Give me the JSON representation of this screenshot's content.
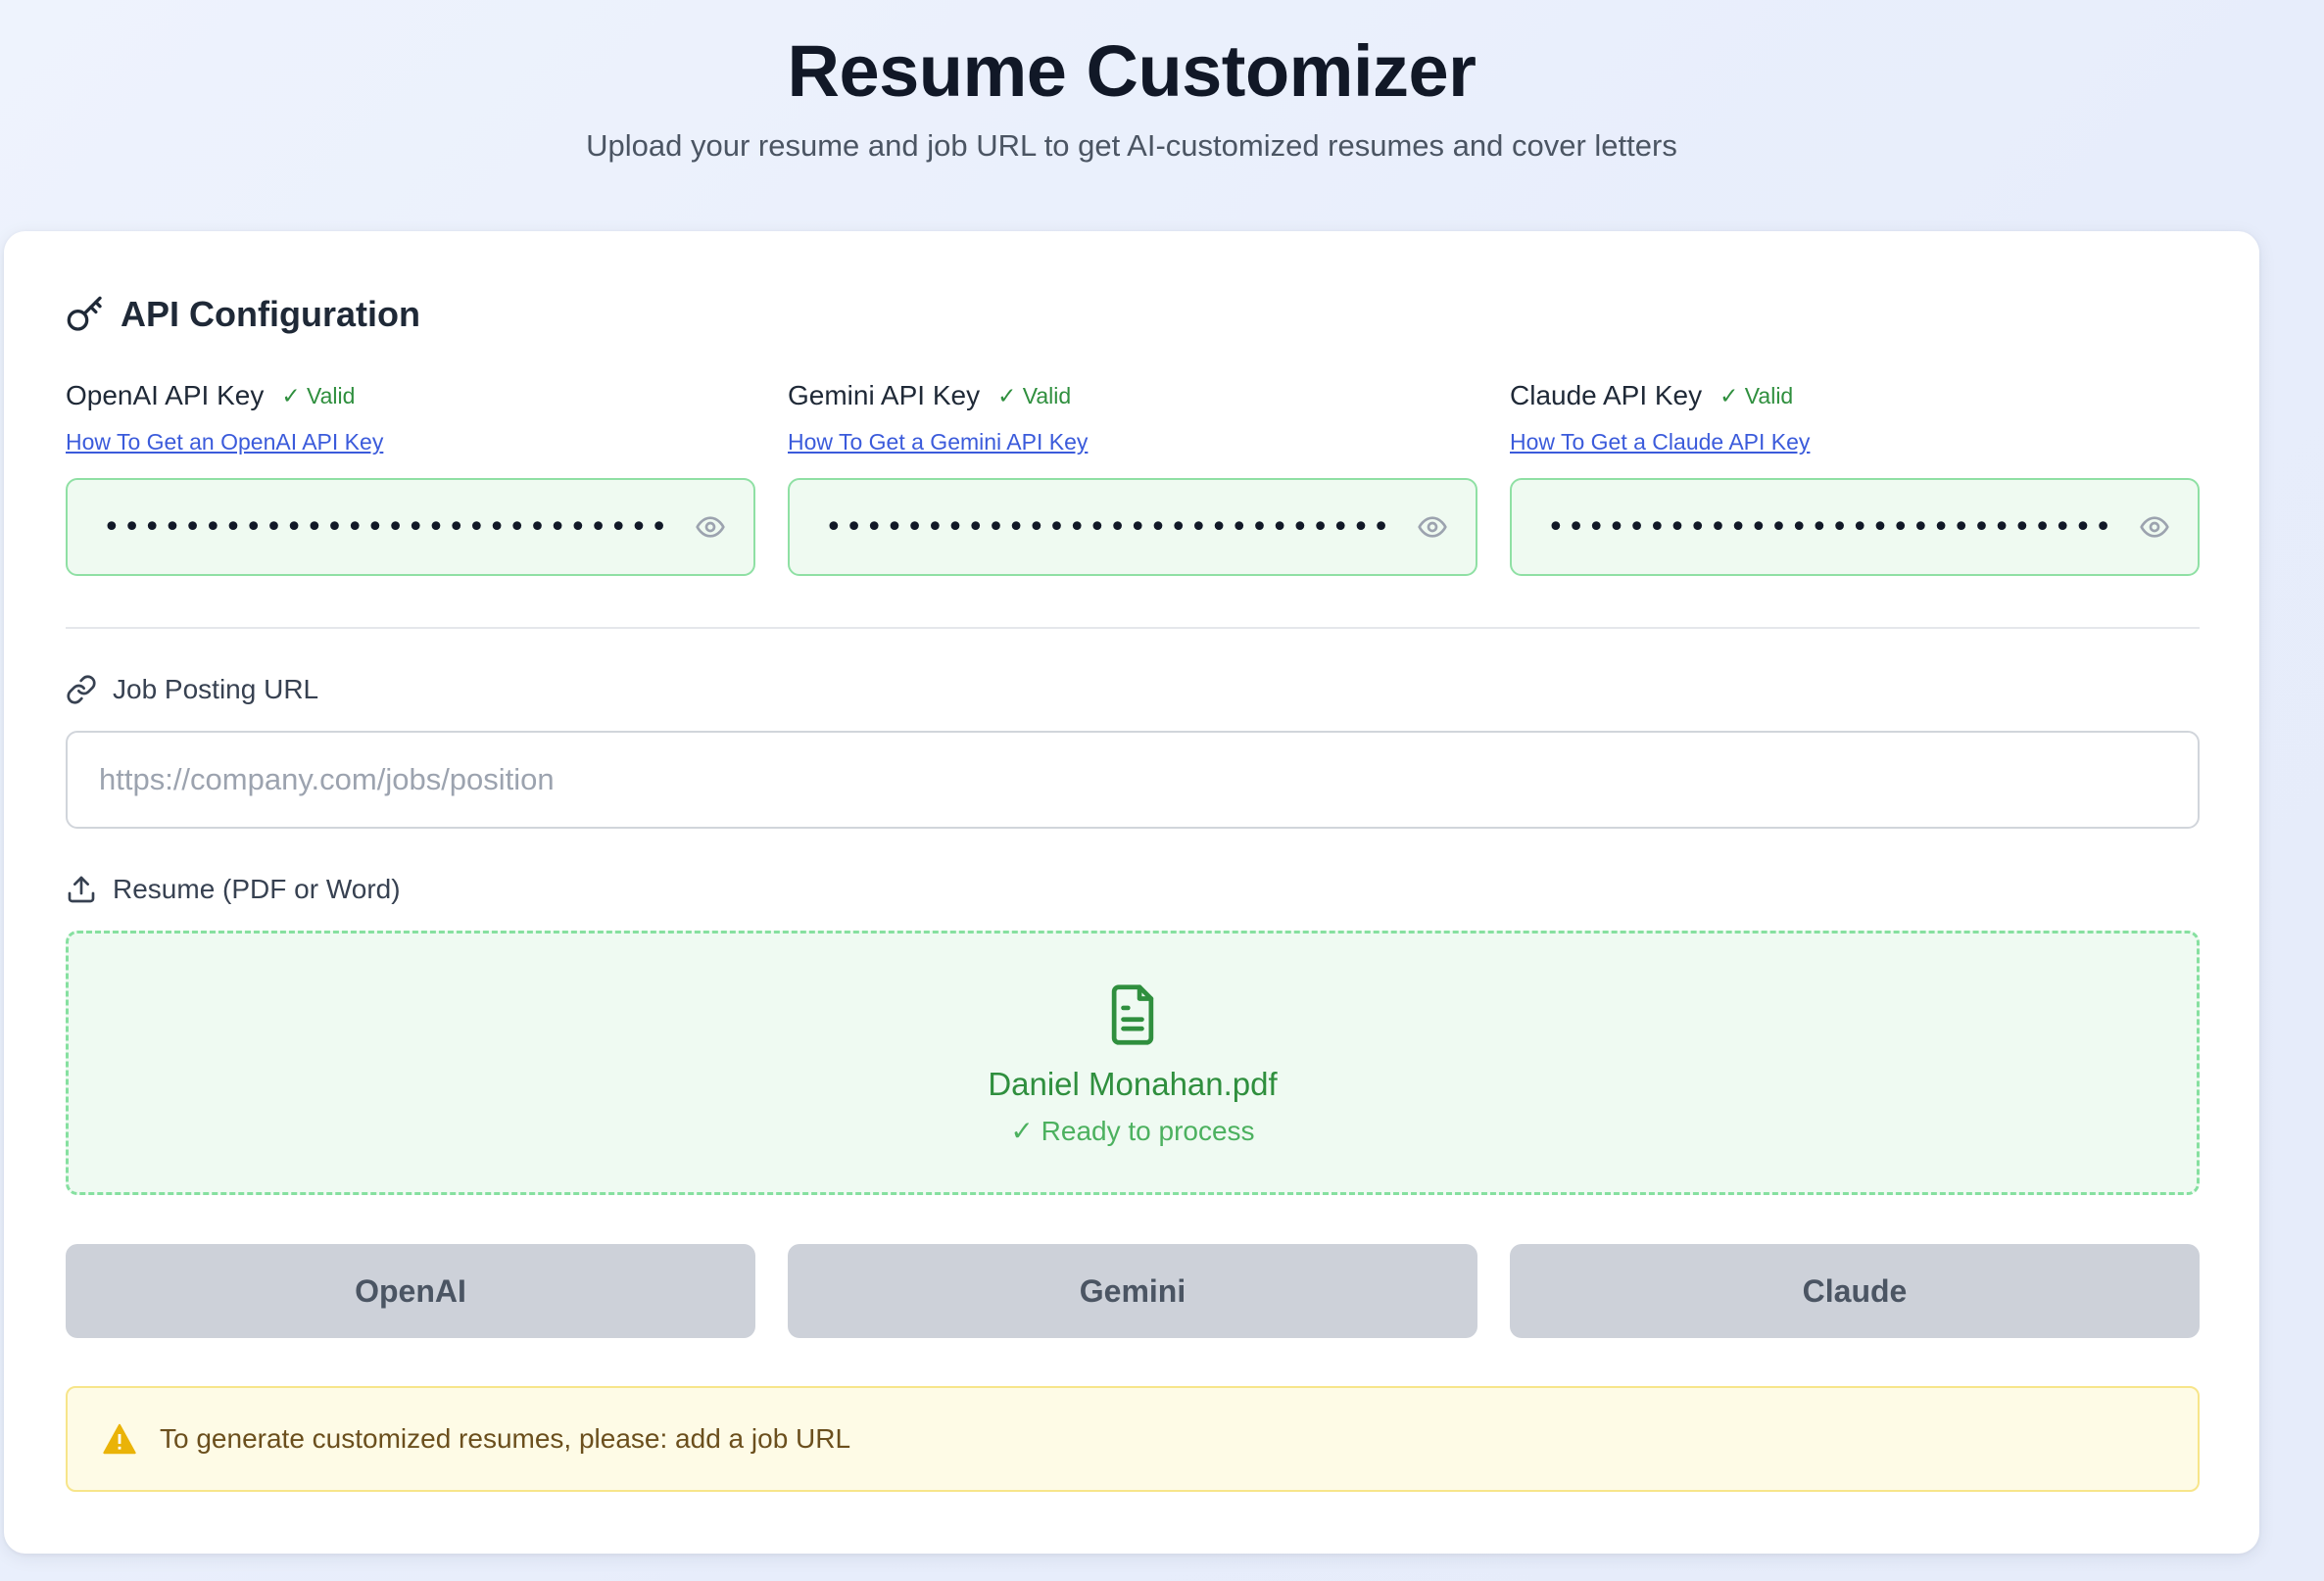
{
  "header": {
    "title": "Resume Customizer",
    "subtitle": "Upload your resume and job URL to get AI-customized resumes and cover letters"
  },
  "api_config": {
    "title": "API Configuration",
    "icon": "key-icon",
    "keys": [
      {
        "label": "OpenAI API Key",
        "status": "✓ Valid",
        "link": "How To Get an OpenAI API Key",
        "value": "••••••••••••••••••••••••••••••••••••••••••••"
      },
      {
        "label": "Gemini API Key",
        "status": "✓ Valid",
        "link": "How To Get a Gemini API Key",
        "value": "•••••••••••••••••••••••••••••••••••••••"
      },
      {
        "label": "Claude API Key",
        "status": "✓ Valid",
        "link": "How To Get a Claude API Key",
        "value": "••••••••••••••••••••••••••••••••••••••••••"
      }
    ]
  },
  "job_url": {
    "label": "Job Posting URL",
    "icon": "link-icon",
    "placeholder": "https://company.com/jobs/position",
    "value": ""
  },
  "resume": {
    "label": "Resume (PDF or Word)",
    "icon": "upload-icon",
    "file_name": "Daniel Monahan.pdf",
    "status": "✓ Ready to process"
  },
  "providers": {
    "openai": "OpenAI",
    "gemini": "Gemini",
    "claude": "Claude"
  },
  "warning": {
    "icon": "warning-icon",
    "text": "To generate customized resumes, please: add a job URL"
  },
  "colors": {
    "valid_green": "#2f8f3e",
    "link_blue": "#3b5bdb",
    "disabled_button": "#cdd1d9",
    "warning_bg": "#fefbe6"
  }
}
